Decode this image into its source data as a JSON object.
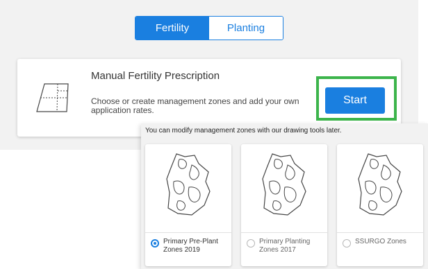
{
  "toggle": {
    "fertility_label": "Fertility",
    "planting_label": "Planting",
    "selected": "Fertility"
  },
  "prescription_card": {
    "icon": "field-grid-icon",
    "title": "Manual Fertility Prescription",
    "description": "Choose or create management zones and add your own application rates.",
    "start_label": "Start"
  },
  "zones_popover": {
    "hint": "You can modify management zones with our drawing tools later.",
    "options": [
      {
        "label": "Primary Pre-Plant Zones 2019",
        "selected": true
      },
      {
        "label": "Primary Planting Zones 2017",
        "selected": false
      },
      {
        "label": "SSURGO Zones",
        "selected": false
      }
    ]
  },
  "colors": {
    "accent": "#1a7fe0",
    "highlight": "#3cb44b",
    "background": "#f2f2f2"
  }
}
